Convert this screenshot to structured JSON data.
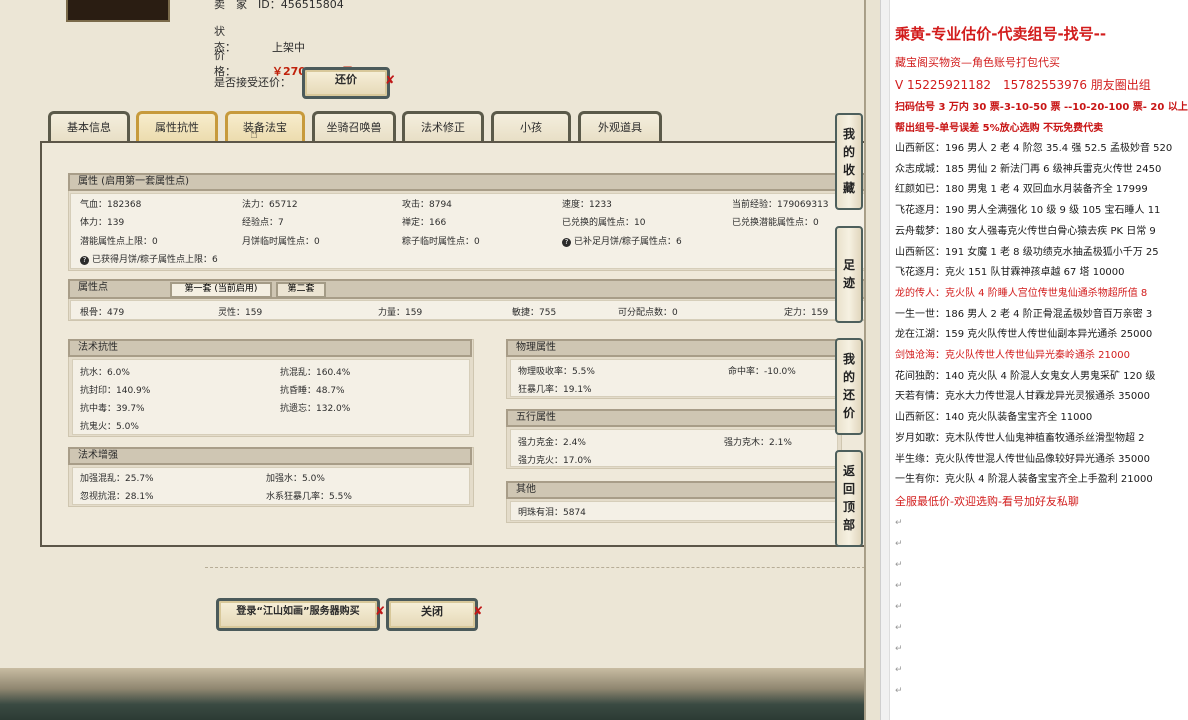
{
  "seller": {
    "id_label": "卖　家　ID：",
    "id_value": "456515804",
    "status_label": "状　　　态：",
    "status_value": "上架中",
    "price_label": "价　　　格：",
    "price_value": "￥2700.00 (元)",
    "bargain_label": "是否接受还价：",
    "bargain_button": "还价"
  },
  "tabs": [
    "基本信息",
    "属性抗性",
    "装备法宝",
    "坐骑召唤兽",
    "法术修正",
    "小孩",
    "外观道具"
  ],
  "attributes": {
    "header": "属性 (启用第一套属性点)",
    "rows": [
      [
        "气血：182368",
        "法力：65712",
        "攻击：8794",
        "速度：1233",
        "当前经验：179069313"
      ],
      [
        "体力：139",
        "经验点：7",
        "禅定：166",
        "已兑换的属性点：10",
        "已兑换潜能属性点：0"
      ],
      [
        "潜能属性点上限：0",
        "月饼临时属性点：0",
        "粽子临时属性点：0",
        "已补足月饼/粽子属性点：6",
        ""
      ]
    ],
    "extra": "已获得月饼/粽子属性点上限：6"
  },
  "points": {
    "header": "属性点",
    "subtab1": "第一套 (当前启用)",
    "subtab2": "第二套",
    "row": [
      "根骨：479",
      "灵性：159",
      "力量：159",
      "敏捷：755",
      "可分配点数：0",
      "定力：159"
    ]
  },
  "resist": {
    "header": "法术抗性",
    "rows": [
      [
        "抗水：6.0%",
        "抗混乱：160.4%"
      ],
      [
        "抗封印：140.9%",
        "抗昏睡：48.7%"
      ],
      [
        "抗中毒：39.7%",
        "抗遗忘：132.0%"
      ],
      [
        "抗鬼火：5.0%",
        ""
      ]
    ]
  },
  "enhance": {
    "header": "法术增强",
    "rows": [
      [
        "加强混乱：25.7%",
        "加强水：5.0%"
      ],
      [
        "忽视抗混：28.1%",
        "水系狂暴几率：5.5%"
      ]
    ]
  },
  "physical": {
    "header": "物理属性",
    "rows": [
      [
        "物理吸收率：5.5%",
        "命中率：-10.0%"
      ],
      [
        "狂暴几率：19.1%",
        ""
      ]
    ]
  },
  "elements": {
    "header": "五行属性",
    "rows": [
      [
        "强力克金：2.4%",
        "强力克木：2.1%"
      ],
      [
        "强力克火：17.0%",
        ""
      ]
    ]
  },
  "other": {
    "header": "其他",
    "rows": [
      [
        "明珠有泪：5874"
      ]
    ]
  },
  "side_buttons": [
    [
      "我",
      "的",
      "收",
      "藏"
    ],
    [
      "足",
      "迹"
    ],
    [
      "我",
      "的",
      "还",
      "价"
    ],
    [
      "返",
      "回",
      "顶",
      "部"
    ]
  ],
  "bottom_buttons": {
    "login": "登录“江山如画”服务器购买",
    "close": "关闭"
  },
  "doc": {
    "title": "乘黄-专业估价-代卖组号-找号--",
    "line1": "藏宝阁买物资—角色账号打包代买",
    "line2": "V 15225921182　15782553976 朋友圈出组",
    "line3": "扫码估号 3 万内 30 票-3-10-50 票 --10-20-100 票- 20 以上",
    "line4": "帮出组号-单号误差 5%放心选购 不玩免费代卖",
    "listings": [
      {
        "text": "山西新区：196 男人 2 老 4 阶忽 35.4 强 52.5 孟极妙音 520",
        "red": false
      },
      {
        "text": "众志成城：185 男仙 2 新法门再 6 级神兵雷克火传世 2450",
        "red": false
      },
      {
        "text": "红颜如已：180 男鬼 1 老 4 双回血水月装备齐全 17999",
        "red": false
      },
      {
        "text": "飞花逐月：190 男人全满强化 10 级 9 级 105 宝石睡人 11",
        "red": false
      },
      {
        "text": "云舟载梦：180 女人强毒克火传世白骨心猿去疾 PK 日常 9",
        "red": false
      },
      {
        "text": "山西新区：191 女魔 1 老 8 级功绩克水抽孟极狐小千万 25",
        "red": false
      },
      {
        "text": "飞花逐月：克火 151 队甘霖神孩卓越 67 塔 10000",
        "red": false
      },
      {
        "text": "龙的传人：克火队 4 阶睡人宫位传世鬼仙通杀物超所值 8",
        "red": true
      },
      {
        "text": "一生一世：186 男人 2 老 4 阶正骨混孟极妙音百万亲密 3",
        "red": false
      },
      {
        "text": "龙在江湖：159 克火队传世人传世仙副本异光通杀 25000",
        "red": false
      },
      {
        "text": "剑蚀沧海：克火队传世人传世仙异光秦岭通杀 21000",
        "red": true
      },
      {
        "text": "花间独酌：140 克火队 4 阶混人女鬼女人男鬼采矿 120 级",
        "red": false
      },
      {
        "text": "天若有情：克水大力传世混人甘霖龙异光灵猴通杀 35000",
        "red": false
      },
      {
        "text": "山西新区：140 克火队装备宝宝齐全 11000",
        "red": false
      },
      {
        "text": "岁月如歌：克木队传世人仙鬼神植畜牧通杀丝滑型物超 2",
        "red": false
      },
      {
        "text": "半生缘：克火队传世混人传世仙品像较好异光通杀 35000",
        "red": false
      },
      {
        "text": "一生有你：克火队 4 阶混人装备宝宝齐全上手盈利 21000",
        "red": false
      }
    ],
    "footer": "全服最低价-欢迎选购-看号加好友私聊",
    "para_mark": "↵",
    "help_glyph": "?"
  },
  "colors": {
    "accent_red": "#d21c1c",
    "price_red": "#c0210b",
    "panel_bg": "#efe9da"
  }
}
